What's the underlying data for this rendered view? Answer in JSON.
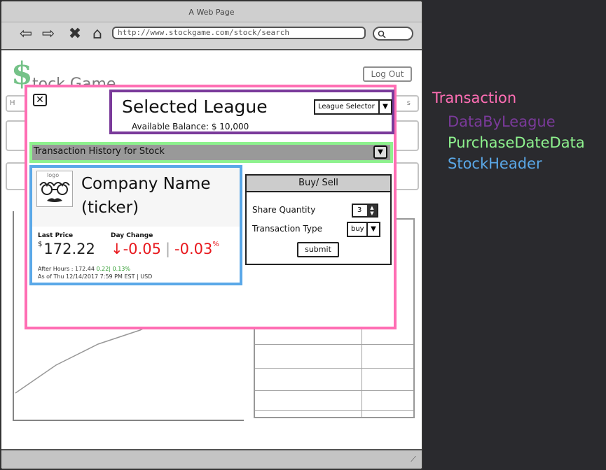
{
  "browser": {
    "window_title": "A Web Page",
    "url": "http://www.stockgame.com/stock/search"
  },
  "background_app": {
    "logo_symbol": "$",
    "logo_text": "tock Game",
    "logout_label": "Log Out",
    "tab_partial_left": "H",
    "tab_partial_right": "s"
  },
  "transaction": {
    "close_icon": "close-icon",
    "league": {
      "title": "Selected League",
      "balance_label": "Available Balance: $ 10,000",
      "selector_value": "League Selector"
    },
    "purchase": {
      "label": "Transaction History for Stock"
    },
    "stock": {
      "logo_text": "logo",
      "company_name": "Company Name",
      "ticker": "(ticker)",
      "last_price_label": "Last Price",
      "day_change_label": "Day Change",
      "currency": "$",
      "price": "172.22",
      "change_arrow": "↓",
      "change": "-0.05",
      "change_pct": "-0.03",
      "pct_sign": "%",
      "after_hours_label": "After Hours :",
      "after_hours_price": "172.44",
      "after_hours_change": "0.22| 0.13%",
      "as_of": "As of  Thu 12/14/2017 7:59 PM    EST | USD"
    },
    "buysell": {
      "header": "Buy/ Sell",
      "share_quantity_label": "Share Quantity",
      "share_quantity_value": "3",
      "transaction_type_label": "Transaction Type",
      "transaction_type_value": "buy",
      "submit_label": "submit"
    }
  },
  "legend": {
    "items": [
      {
        "label": "Transaction",
        "color": "#ff6eb4"
      },
      {
        "label": "DataByLeague",
        "color": "#7a3a9a"
      },
      {
        "label": "PurchaseDateData",
        "color": "#8ef28e"
      },
      {
        "label": "StockHeader",
        "color": "#5aa8e8"
      }
    ]
  }
}
